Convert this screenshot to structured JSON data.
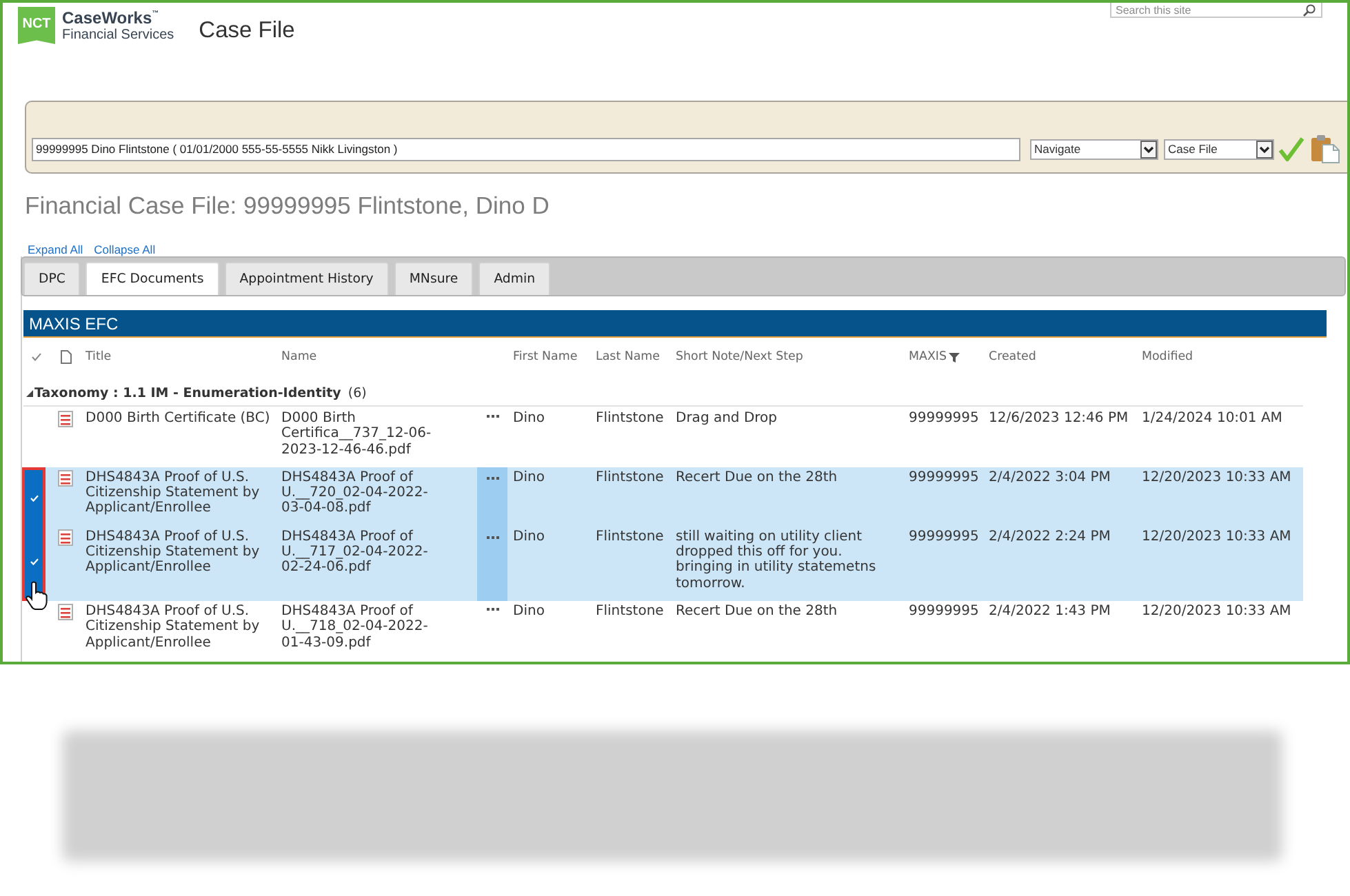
{
  "header": {
    "logo": {
      "badge": "NCT",
      "name": "CaseWorks$^{™}$",
      "subtitle": "Financial Services"
    },
    "title": "Case File",
    "search": {
      "placeholder": "Search this site"
    }
  },
  "case_bar": {
    "case_field": {
      "value": "99999995 Dino Flintstone ( 01/01/2000 555-55-5555 Nikk Livingston )"
    },
    "selects": [
      {
        "value": "Navigate"
      },
      {
        "value": "Case File"
      }
    ]
  },
  "heading": "Financial Case File: 99999995 Flintstone, Dino D",
  "links": [
    "Expand All",
    "Collapse All"
  ],
  "tabs": [
    {
      "label": "DPC",
      "selected": false
    },
    {
      "label": "EFC Documents",
      "selected": true
    },
    {
      "label": "Appointment History",
      "selected": false
    },
    {
      "label": "MNsure",
      "selected": false
    },
    {
      "label": "Admin",
      "selected": false
    }
  ],
  "list": {
    "title": "MAXIS EFC",
    "columns": [
      {
        "label": "Title",
        "filtered": false
      },
      {
        "label": "Name",
        "filtered": false
      },
      {
        "label": "First Name",
        "filtered": false
      },
      {
        "label": "Last Name",
        "filtered": false
      },
      {
        "label": "Short Note/Next Step",
        "filtered": false
      },
      {
        "label": "MAXIS",
        "filtered": true
      },
      {
        "label": "Created",
        "filtered": false
      },
      {
        "label": "Modified",
        "filtered": false
      }
    ],
    "group": {
      "label": "Taxonomy : 1.1 IM - Enumeration-Identity",
      "count": "(6)",
      "expanded": true
    },
    "rows": [
      {
        "title": "D000 Birth Certificate (BC)",
        "name": "D000 Birth Certifica__737_12-06-2023-12-46-46.pdf",
        "first_name": "Dino",
        "last_name": "Flintstone",
        "note": "Drag and Drop",
        "maxis": "99999995",
        "created": "12/6/2023 12:46 PM",
        "modified": "1/24/2024 10:01 AM",
        "selected": false
      },
      {
        "title": "DHS4843A Proof of U.S. Citizenship Statement by Applicant/Enrollee",
        "name": "DHS4843A Proof of U.__720_02-04-2022-03-04-08.pdf",
        "first_name": "Dino",
        "last_name": "Flintstone",
        "note": "Recert Due on the 28th",
        "maxis": "99999995",
        "created": "2/4/2022 3:04 PM",
        "modified": "12/20/2023 10:33 AM",
        "selected": true
      },
      {
        "title": "DHS4843A Proof of U.S. Citizenship Statement by Applicant/Enrollee",
        "name": "DHS4843A Proof of U.__717_02-04-2022-02-24-06.pdf",
        "first_name": "Dino",
        "last_name": "Flintstone",
        "note": "still waiting on utility client dropped this off for you. bringing in utility statemetns tomorrow.",
        "maxis": "99999995",
        "created": "2/4/2022 2:24 PM",
        "modified": "12/20/2023 10:33 AM",
        "selected": true
      },
      {
        "title": "DHS4843A Proof of U.S. Citizenship Statement by Applicant/Enrollee",
        "name": "DHS4843A Proof of U.__718_02-04-2022-01-43-09.pdf",
        "first_name": "Dino",
        "last_name": "Flintstone",
        "note": "Recert Due on the 28th",
        "maxis": "99999995",
        "created": "2/4/2022 1:43 PM",
        "modified": "12/20/2023 10:33 AM",
        "selected": false
      }
    ]
  }
}
